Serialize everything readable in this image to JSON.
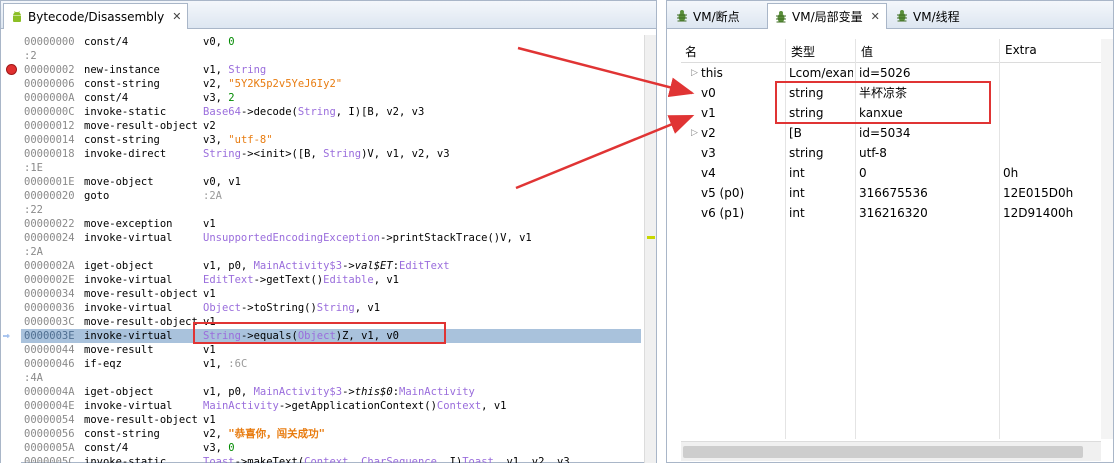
{
  "left_panel": {
    "tab_title": "Bytecode/Disassembly",
    "tab_close": "✕"
  },
  "code_lines": [
    {
      "addr": "00000000",
      "op": "const/4",
      "args": [
        {
          "t": "v0, "
        },
        {
          "t": "0",
          "c": "num"
        }
      ]
    },
    {
      "label": ":2"
    },
    {
      "addr": "00000002",
      "op": "new-instance",
      "args": [
        {
          "t": "v1, "
        },
        {
          "t": "String",
          "c": "cls"
        }
      ],
      "breakpoint": true
    },
    {
      "addr": "00000006",
      "op": "const-string",
      "args": [
        {
          "t": "v2, "
        },
        {
          "t": "\"5Y2K5p2v5YeJ6Iy2\"",
          "c": "str"
        }
      ]
    },
    {
      "addr": "0000000A",
      "op": "const/4",
      "args": [
        {
          "t": "v3, "
        },
        {
          "t": "2",
          "c": "num"
        }
      ]
    },
    {
      "addr": "0000000C",
      "op": "invoke-static",
      "args": [
        {
          "t": "Base64",
          "c": "cls"
        },
        {
          "t": "->decode("
        },
        {
          "t": "String",
          "c": "cls"
        },
        {
          "t": ", I)[B, v2, v3"
        }
      ]
    },
    {
      "addr": "00000012",
      "op": "move-result-object",
      "args": [
        {
          "t": "v2"
        }
      ]
    },
    {
      "addr": "00000014",
      "op": "const-string",
      "args": [
        {
          "t": "v3, "
        },
        {
          "t": "\"utf-8\"",
          "c": "str"
        }
      ]
    },
    {
      "addr": "00000018",
      "op": "invoke-direct",
      "args": [
        {
          "t": "String",
          "c": "cls"
        },
        {
          "t": "-><init>([B, "
        },
        {
          "t": "String",
          "c": "cls"
        },
        {
          "t": ")V, v1, v2, v3"
        }
      ]
    },
    {
      "label": ":1E"
    },
    {
      "addr": "0000001E",
      "op": "move-object",
      "args": [
        {
          "t": "v0, v1"
        }
      ]
    },
    {
      "addr": "00000020",
      "op": "goto",
      "args": [
        {
          "t": ":2A",
          "c": "gry"
        }
      ]
    },
    {
      "label": ":22"
    },
    {
      "addr": "00000022",
      "op": "move-exception",
      "args": [
        {
          "t": "v1"
        }
      ]
    },
    {
      "addr": "00000024",
      "op": "invoke-virtual",
      "args": [
        {
          "t": "UnsupportedEncodingException",
          "c": "cls"
        },
        {
          "t": "->printStackTrace()V, v1"
        }
      ]
    },
    {
      "label": ":2A"
    },
    {
      "addr": "0000002A",
      "op": "iget-object",
      "args": [
        {
          "t": "v1, p0, "
        },
        {
          "t": "MainActivity$3",
          "c": "cls"
        },
        {
          "t": "->"
        },
        {
          "t": "val$ET",
          "c": "ital"
        },
        {
          "t": ":"
        },
        {
          "t": "EditText",
          "c": "cls"
        }
      ]
    },
    {
      "addr": "0000002E",
      "op": "invoke-virtual",
      "args": [
        {
          "t": "EditText",
          "c": "cls"
        },
        {
          "t": "->getText()"
        },
        {
          "t": "Editable",
          "c": "cls"
        },
        {
          "t": ", v1"
        }
      ]
    },
    {
      "addr": "00000034",
      "op": "move-result-object",
      "args": [
        {
          "t": "v1"
        }
      ]
    },
    {
      "addr": "00000036",
      "op": "invoke-virtual",
      "args": [
        {
          "t": "Object",
          "c": "cls"
        },
        {
          "t": "->toString()"
        },
        {
          "t": "String",
          "c": "cls"
        },
        {
          "t": ", v1"
        }
      ]
    },
    {
      "addr": "0000003C",
      "op": "move-result-object",
      "args": [
        {
          "t": "v1"
        }
      ]
    },
    {
      "addr": "0000003E",
      "op": "invoke-virtual",
      "args": [
        {
          "t": "String",
          "c": "cls"
        },
        {
          "t": "->equals("
        },
        {
          "t": "Object",
          "c": "cls"
        },
        {
          "t": ")Z, v1, v0"
        }
      ],
      "current": true
    },
    {
      "addr": "00000044",
      "op": "move-result",
      "args": [
        {
          "t": "v1"
        }
      ]
    },
    {
      "addr": "00000046",
      "op": "if-eqz",
      "args": [
        {
          "t": "v1, "
        },
        {
          "t": ":6C",
          "c": "gry"
        }
      ]
    },
    {
      "label": ":4A"
    },
    {
      "addr": "0000004A",
      "op": "iget-object",
      "args": [
        {
          "t": "v1, p0, "
        },
        {
          "t": "MainActivity$3",
          "c": "cls"
        },
        {
          "t": "->"
        },
        {
          "t": "this$0",
          "c": "ital"
        },
        {
          "t": ":"
        },
        {
          "t": "MainActivity",
          "c": "cls"
        }
      ]
    },
    {
      "addr": "0000004E",
      "op": "invoke-virtual",
      "args": [
        {
          "t": "MainActivity",
          "c": "cls"
        },
        {
          "t": "->getApplicationContext()"
        },
        {
          "t": "Context",
          "c": "cls"
        },
        {
          "t": ", v1"
        }
      ]
    },
    {
      "addr": "00000054",
      "op": "move-result-object",
      "args": [
        {
          "t": "v1"
        }
      ]
    },
    {
      "addr": "00000056",
      "op": "const-string",
      "args": [
        {
          "t": "v2, "
        },
        {
          "t": "\"恭喜你，闯关成功\"",
          "c": "strb"
        }
      ]
    },
    {
      "addr": "0000005A",
      "op": "const/4",
      "args": [
        {
          "t": "v3, "
        },
        {
          "t": "0",
          "c": "num"
        }
      ]
    },
    {
      "addr": "0000005C",
      "op": "invoke-static",
      "args": [
        {
          "t": "Toast",
          "c": "cls"
        },
        {
          "t": "->makeText("
        },
        {
          "t": "Context",
          "c": "cls"
        },
        {
          "t": ", "
        },
        {
          "t": "CharSequence",
          "c": "cls"
        },
        {
          "t": ", I)"
        },
        {
          "t": "Toast",
          "c": "cls"
        },
        {
          "t": ", v1, v2, v3"
        }
      ]
    }
  ],
  "right_panel": {
    "tabs": [
      {
        "label": "VM/断点",
        "icon": "bug-icon",
        "active": false
      },
      {
        "label": "VM/局部变量",
        "icon": "bug-icon",
        "active": true,
        "close": "✕"
      },
      {
        "label": "VM/线程",
        "icon": "bug-icon",
        "active": false
      }
    ],
    "columns": [
      "名",
      "类型",
      "值",
      "Extra"
    ],
    "variables": [
      {
        "name": "this",
        "type": "Lcom/exam",
        "value": "id=5026",
        "extra": "",
        "expandable": true
      },
      {
        "name": "v0",
        "type": "string",
        "value": "半杯凉茶",
        "extra": "",
        "expandable": false
      },
      {
        "name": "v1",
        "type": "string",
        "value": "kanxue",
        "extra": "",
        "expandable": false
      },
      {
        "name": "v2",
        "type": "[B",
        "value": "id=5034",
        "extra": "",
        "expandable": true
      },
      {
        "name": "v3",
        "type": "string",
        "value": "utf-8",
        "extra": "",
        "expandable": false
      },
      {
        "name": "v4",
        "type": "int",
        "value": "0",
        "extra": "0h",
        "expandable": false
      },
      {
        "name": "v5 (p0)",
        "type": "int",
        "value": "316675536",
        "extra": "12E015D0h",
        "expandable": false
      },
      {
        "name": "v6 (p1)",
        "type": "int",
        "value": "316216320",
        "extra": "12D91400h",
        "expandable": false
      }
    ]
  },
  "colors": {
    "annotation_red": "#e03434",
    "current_line": "#a9c2dc",
    "class_purple": "#9a6ddc",
    "string_orange": "#e87c10",
    "number_green": "#008a00"
  }
}
